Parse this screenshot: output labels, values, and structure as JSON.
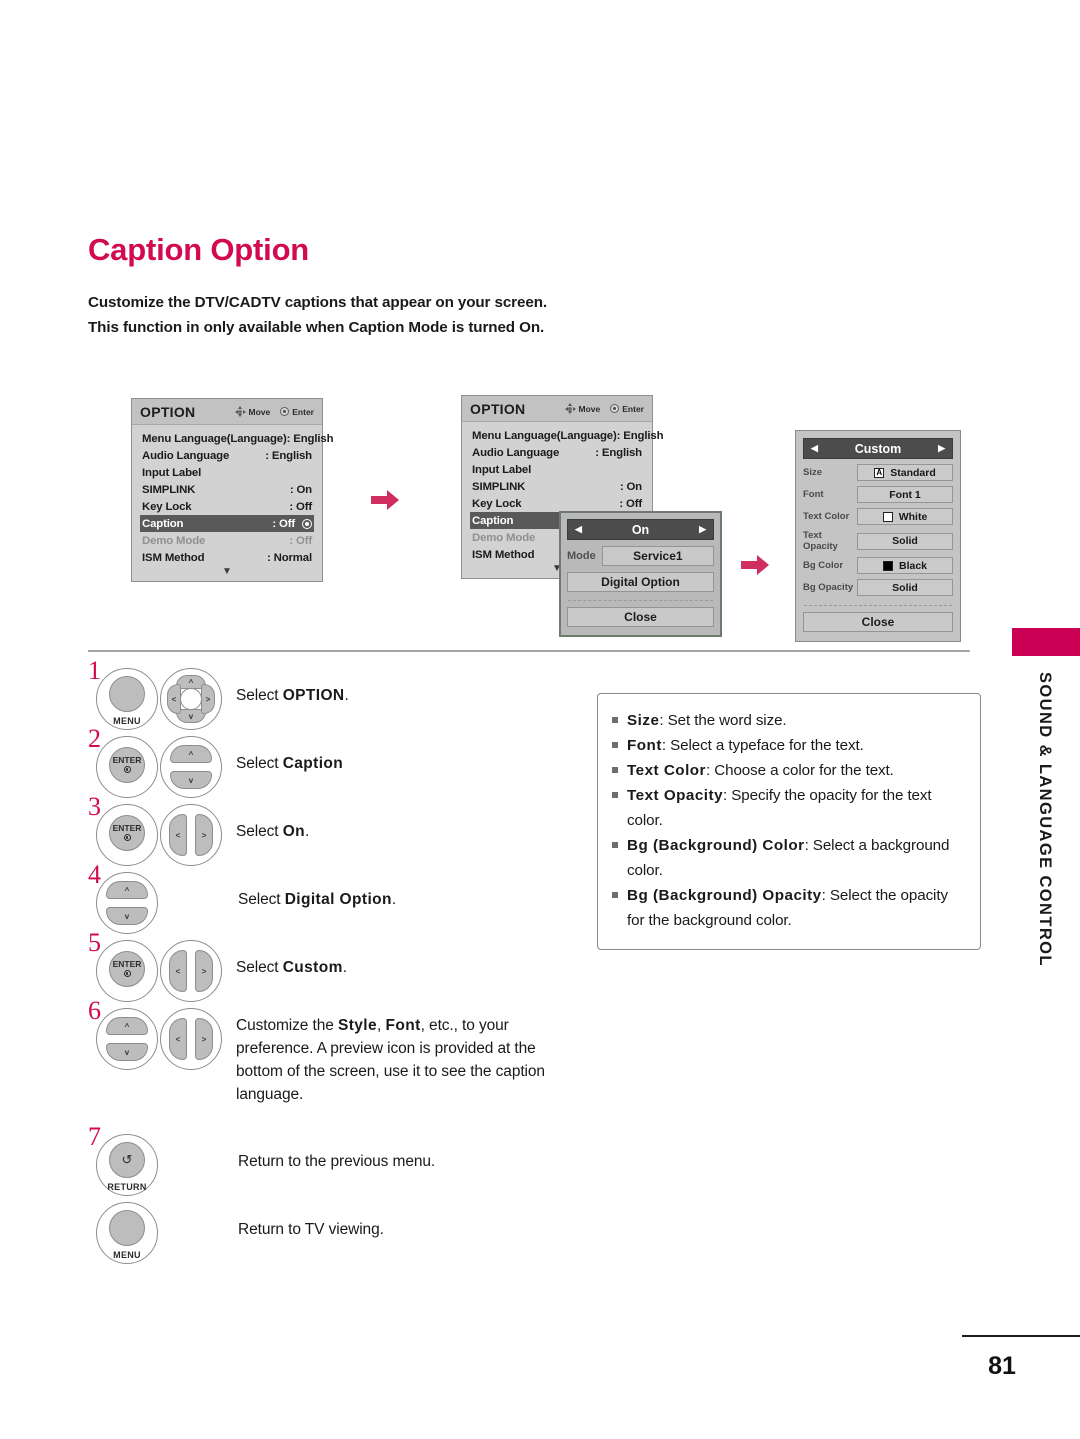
{
  "document": {
    "title": "Caption Option",
    "intro_line1": "Customize the DTV/CADTV captions that appear on your screen.",
    "intro_line2_a": "This function in only available when ",
    "intro_line2_b": "Caption",
    "intro_line2_c": " Mode is turned ",
    "intro_line2_d": "On.",
    "page_number": "81",
    "sidebar_label": "SOUND & LANGUAGE CONTROL",
    "accent_color": "#d10a51",
    "sidebar_tab_color": "#cb0055",
    "arrow_color": "#cf2e5f"
  },
  "osd_panel_1": {
    "header_title": "OPTION",
    "hint_move": "Move",
    "hint_enter": "Enter",
    "rows": [
      {
        "label": "Menu Language(Language): English",
        "value": "",
        "state": "full"
      },
      {
        "label": "Audio Language",
        "value": ": English",
        "state": "normal"
      },
      {
        "label": "Input Label",
        "value": "",
        "state": "normal"
      },
      {
        "label": "SIMPLINK",
        "value": ": On",
        "state": "normal"
      },
      {
        "label": "Key Lock",
        "value": ": Off",
        "state": "normal"
      },
      {
        "label": "Caption",
        "value": ": Off",
        "state": "selected"
      },
      {
        "label": "Demo Mode",
        "value": ": Off",
        "state": "dim"
      },
      {
        "label": "ISM Method",
        "value": ": Normal",
        "state": "normal"
      }
    ],
    "more_indicator": "▼"
  },
  "osd_panel_2": {
    "header_title": "OPTION",
    "hint_move": "Move",
    "hint_enter": "Enter",
    "rows": [
      {
        "label": "Menu Language(Language): English",
        "value": "",
        "state": "full"
      },
      {
        "label": "Audio Language",
        "value": ": English",
        "state": "normal"
      },
      {
        "label": "Input Label",
        "value": "",
        "state": "normal"
      },
      {
        "label": "SIMPLINK",
        "value": ": On",
        "state": "normal"
      },
      {
        "label": "Key Lock",
        "value": ": Off",
        "state": "normal"
      },
      {
        "label": "Caption",
        "value": "",
        "state": "selected-plain"
      },
      {
        "label": "Demo Mode",
        "value": "",
        "state": "dim"
      },
      {
        "label": "ISM Method",
        "value": "",
        "state": "normal"
      }
    ],
    "more_indicator": "▼"
  },
  "caption_submenu": {
    "left_caret": "◀",
    "right_caret": "▶",
    "selected_value": "On",
    "mode_label": "Mode",
    "mode_value": "Service1",
    "digital_option_label": "Digital Option",
    "close_label": "Close"
  },
  "custom_panel": {
    "left_caret": "◀",
    "right_caret": "▶",
    "title": "Custom",
    "rows": [
      {
        "label": "Size",
        "value": "Standard",
        "swatch": "letter-a-icon",
        "swatch_text": "A"
      },
      {
        "label": "Font",
        "value": "Font 1",
        "swatch": "none",
        "swatch_text": ""
      },
      {
        "label": "Text Color",
        "value": "White",
        "swatch": "white-swatch",
        "swatch_text": ""
      },
      {
        "label": "Text Opacity",
        "value": "Solid",
        "swatch": "none",
        "swatch_text": ""
      },
      {
        "label": "Bg Color",
        "value": "Black",
        "swatch": "black-swatch",
        "swatch_text": ""
      },
      {
        "label": "Bg Opacity",
        "value": "Solid",
        "swatch": "none",
        "swatch_text": ""
      }
    ],
    "close_label": "Close"
  },
  "steps": [
    {
      "num": "1",
      "buttons": [
        "MENU",
        "nav-4way"
      ],
      "text_prefix": "Select ",
      "text_bold": "OPTION",
      "text_suffix": "."
    },
    {
      "num": "2",
      "buttons": [
        "ENTER",
        "nav-updown"
      ],
      "text_prefix": "Select ",
      "text_bold": "Caption",
      "text_suffix": ""
    },
    {
      "num": "3",
      "buttons": [
        "ENTER",
        "nav-leftright"
      ],
      "text_prefix": "Select ",
      "text_bold": "On",
      "text_suffix": "."
    },
    {
      "num": "4",
      "buttons": [
        "nav-updown"
      ],
      "text_prefix": "Select ",
      "text_bold": "Digital Option",
      "text_suffix": "."
    },
    {
      "num": "5",
      "buttons": [
        "ENTER",
        "nav-leftright"
      ],
      "text_prefix": "Select ",
      "text_bold": "Custom",
      "text_suffix": "."
    },
    {
      "num": "6",
      "buttons": [
        "nav-updown",
        "nav-leftright"
      ],
      "text_prefix": "Customize the ",
      "text_bold": "Style",
      "text_bold2": "Font",
      "text_suffix": ", etc., to your preference. A preview icon is provided at the bottom of the screen, use it to see the caption language."
    },
    {
      "num": "7",
      "buttons": [
        "RETURN"
      ],
      "text_prefix": "Return to the previous menu.",
      "text_bold": "",
      "text_suffix": ""
    },
    {
      "num": "",
      "buttons": [
        "MENU"
      ],
      "text_prefix": "Return to TV viewing.",
      "text_bold": "",
      "text_suffix": ""
    }
  ],
  "step_button_labels": {
    "menu": "MENU",
    "enter": "ENTER",
    "return": "RETURN"
  },
  "info_box": {
    "items": [
      {
        "term": "Size",
        "desc": ": Set the word size."
      },
      {
        "term": "Font",
        "desc": ": Select a typeface for the text."
      },
      {
        "term": "Text Color",
        "desc": ": Choose a color for the text."
      },
      {
        "term": "Text Opacity",
        "desc": ": Specify the opacity for the text color."
      },
      {
        "term": "Bg (Background) Color",
        "desc": ": Select a background color."
      },
      {
        "term": "Bg (Background) Opacity",
        "desc": ": Select the opacity for the background color."
      }
    ]
  }
}
